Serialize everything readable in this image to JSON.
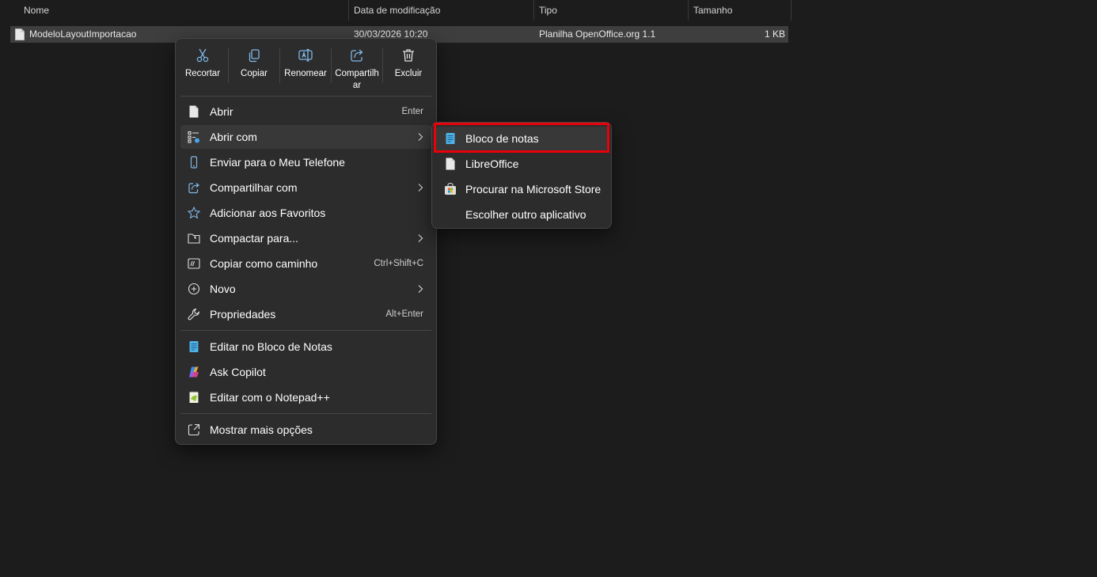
{
  "columns": {
    "name": "Nome",
    "modified": "Data de modificação",
    "type": "Tipo",
    "size": "Tamanho"
  },
  "file": {
    "name": "ModeloLayoutImportacao",
    "modified": "30/03/2026 10:20",
    "type": "Planilha OpenOffice.org 1.1",
    "size": "1 KB",
    "icon": "document-icon"
  },
  "quick_actions": [
    {
      "label": "Recortar",
      "icon": "scissors-icon"
    },
    {
      "label": "Copiar",
      "icon": "copy-icon"
    },
    {
      "label": "Renomear",
      "icon": "rename-icon"
    },
    {
      "label": "Compartilhar",
      "icon": "share-icon"
    },
    {
      "label": "Excluir",
      "icon": "trash-icon"
    }
  ],
  "menu_items": [
    {
      "label": "Abrir",
      "shortcut": "Enter",
      "icon": "document-icon"
    },
    {
      "label": "Abrir com",
      "submenu": true,
      "icon": "open-with-icon"
    },
    {
      "label": "Enviar para o Meu Telefone",
      "icon": "phone-icon"
    },
    {
      "label": "Compartilhar com",
      "submenu": true,
      "icon": "share-icon"
    },
    {
      "label": "Adicionar aos Favoritos",
      "icon": "star-icon"
    },
    {
      "label": "Compactar para...",
      "submenu": true,
      "icon": "zip-folder-icon"
    },
    {
      "label": "Copiar como caminho",
      "shortcut": "Ctrl+Shift+C",
      "icon": "copy-path-icon"
    },
    {
      "label": "Novo",
      "submenu": true,
      "icon": "plus-circle-icon"
    },
    {
      "label": "Propriedades",
      "shortcut": "Alt+Enter",
      "icon": "wrench-icon"
    },
    {
      "label": "Editar no Bloco de Notas",
      "icon": "notepad-icon"
    },
    {
      "label": "Ask Copilot",
      "icon": "copilot-icon"
    },
    {
      "label": "Editar com o Notepad++",
      "icon": "notepadpp-icon"
    },
    {
      "label": "Mostrar mais opções",
      "icon": "more-options-icon"
    }
  ],
  "open_with_submenu": [
    {
      "label": "Bloco de notas",
      "icon": "notepad-icon",
      "highlighted": true
    },
    {
      "label": "LibreOffice",
      "icon": "document-icon"
    },
    {
      "label": "Procurar na Microsoft Store",
      "icon": "store-icon"
    },
    {
      "label": "Escolher outro aplicativo",
      "icon": ""
    }
  ],
  "colors": {
    "highlight_border": "#e8000b",
    "menu_bg": "#2c2c2c",
    "window_bg": "#1c1c1c"
  }
}
